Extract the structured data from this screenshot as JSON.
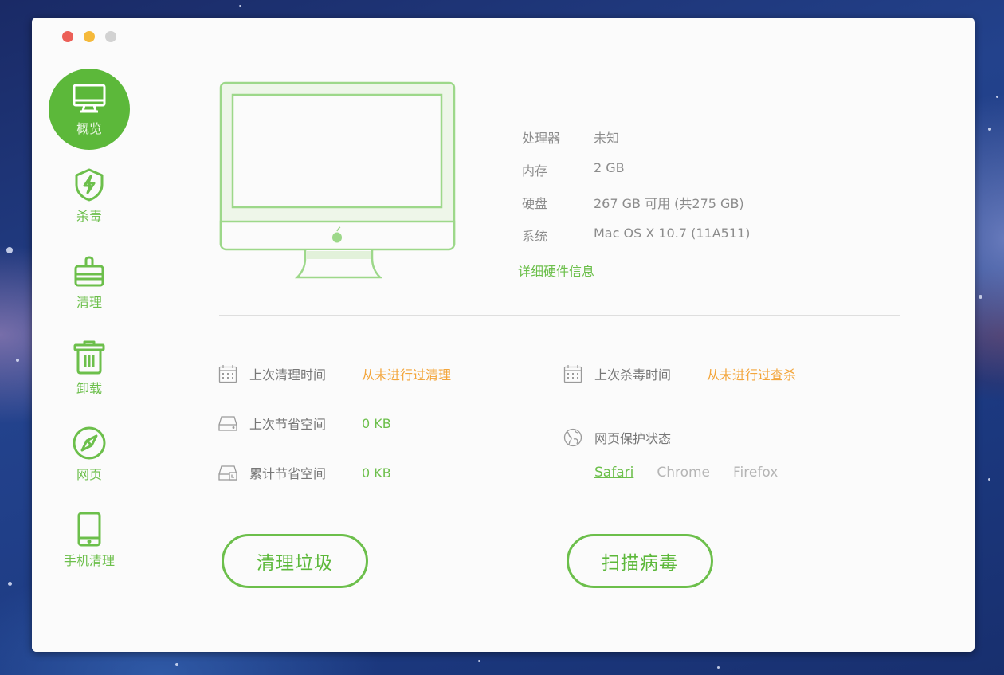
{
  "window": {
    "traffic_lights": [
      "close",
      "minimize",
      "maximize"
    ]
  },
  "sidebar": {
    "items": [
      {
        "label": "概览",
        "icon": "monitor-icon",
        "active": true
      },
      {
        "label": "杀毒",
        "icon": "shield-bolt-icon",
        "active": false
      },
      {
        "label": "清理",
        "icon": "brush-icon",
        "active": false
      },
      {
        "label": "卸载",
        "icon": "trash-icon",
        "active": false
      },
      {
        "label": "网页",
        "icon": "compass-icon",
        "active": false
      },
      {
        "label": "手机清理",
        "icon": "phone-icon",
        "active": false
      }
    ]
  },
  "overview": {
    "specs": [
      {
        "label": "处理器",
        "value": "未知"
      },
      {
        "label": "内存",
        "value": "2 GB"
      },
      {
        "label": "硬盘",
        "value": "267 GB 可用 (共275 GB)"
      },
      {
        "label": "系统",
        "value": "Mac OS X 10.7 (11A511)"
      }
    ],
    "detail_link": "详细硬件信息"
  },
  "stats": {
    "last_clean_time": {
      "label": "上次清理时间",
      "value": "从未进行过清理",
      "icon": "calendar-icon"
    },
    "last_saved": {
      "label": "上次节省空间",
      "value": "0 KB",
      "icon": "drive-icon"
    },
    "total_saved": {
      "label": "累计节省空间",
      "value": "0 KB",
      "icon": "drive-clock-icon"
    },
    "last_scan_time": {
      "label": "上次杀毒时间",
      "value": "从未进行过查杀",
      "icon": "calendar-icon"
    },
    "web_protection": {
      "label": "网页保护状态",
      "icon": "globe-icon"
    }
  },
  "browsers": [
    {
      "name": "Safari",
      "enabled": true
    },
    {
      "name": "Chrome",
      "enabled": false
    },
    {
      "name": "Firefox",
      "enabled": false
    }
  ],
  "buttons": {
    "clean": "清理垃圾",
    "scan": "扫描病毒"
  },
  "colors": {
    "accent": "#5cb83a",
    "warning": "#f3a53a",
    "muted": "#8c8c8c"
  }
}
